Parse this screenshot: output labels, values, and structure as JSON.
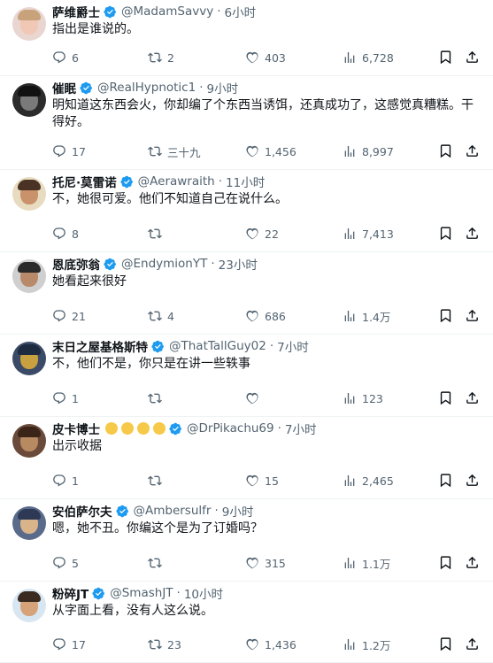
{
  "replies": [
    {
      "name": "萨维爵士",
      "handle": "@MadamSavvy",
      "time": "6小时",
      "text": "指出是谁说的。",
      "replies": "6",
      "reposts": "2",
      "likes": "403",
      "views": "6,728",
      "avatar": {
        "bg": "#e9d6d0",
        "skin": "#f1c7b5",
        "hair": "#c7a27b"
      }
    },
    {
      "name": "催眠",
      "handle": "@RealHypnotic1",
      "time": "9小时",
      "text": "明知道这东西会火，你却编了个东西当诱饵，还真成功了，这感觉真糟糕。干得好。",
      "replies": "17",
      "reposts": "三十九",
      "likes": "1,456",
      "views": "8,997",
      "avatar": {
        "bg": "#2b2b2b",
        "skin": "#7a7a7a",
        "hair": "#111111"
      }
    },
    {
      "name": "托尼·莫雷诺",
      "handle": "@Aerawraith",
      "time": "11小时",
      "text": "不，她很可爱。他们不知道自己在说什么。",
      "replies": "8",
      "reposts": "",
      "likes": "22",
      "views": "7,413",
      "avatar": {
        "bg": "#e8dcc0",
        "skin": "#c9926a",
        "hair": "#4a3324"
      }
    },
    {
      "name": "恩底弥翁",
      "handle": "@EndymionYT",
      "time": "23小时",
      "text": "她看起来很好",
      "replies": "21",
      "reposts": "4",
      "likes": "686",
      "views": "1.4万",
      "avatar": {
        "bg": "#cfcfcf",
        "skin": "#b98a6a",
        "hair": "#2a2a2a"
      }
    },
    {
      "name": "末日之屋基格斯特",
      "handle": "@ThatTallGuy02",
      "time": "7小时",
      "text": "不，他们不是，你只是在讲一些轶事",
      "replies": "1",
      "reposts": "",
      "likes": "",
      "views": "123",
      "avatar": {
        "bg": "#3b4a66",
        "skin": "#c8a040",
        "hair": "#1d2a40"
      }
    },
    {
      "name": "皮卡博士",
      "handle": "@DrPikachu69",
      "time": "7小时",
      "text": "出示收据",
      "replies": "1",
      "reposts": "",
      "likes": "15",
      "views": "2,465",
      "avatar": {
        "bg": "#6a4a3a",
        "skin": "#b88a62",
        "hair": "#3a2418"
      }
    },
    {
      "name": "安伯萨尔夫",
      "handle": "@Ambersulfr",
      "time": "9小时",
      "text": "嗯，她不丑。你编这个是为了订婚吗？",
      "replies": "5",
      "reposts": "",
      "likes": "315",
      "views": "1.1万",
      "avatar": {
        "bg": "#5a6a8a",
        "skin": "#d9b48a",
        "hair": "#2e3a55"
      }
    },
    {
      "name": "粉碎JT",
      "handle": "@SmashJT",
      "time": "10小时",
      "text": "从字面上看，没有人这么说。",
      "replies": "17",
      "reposts": "23",
      "likes": "1,436",
      "views": "1.2万",
      "avatar": {
        "bg": "#d8e6f2",
        "skin": "#d6a27a",
        "hair": "#3a2a20"
      }
    }
  ],
  "colors": {
    "verified": "#1d9bf0",
    "muted": "#536471",
    "text": "#0f1419",
    "divider": "#eff3f4",
    "emoji": "#f7c948"
  },
  "icons": {
    "reply": "reply-icon",
    "repost": "repost-icon",
    "like": "heart-icon",
    "views": "views-icon",
    "bookmark": "bookmark-icon",
    "share": "share-icon",
    "verified": "verified-badge-icon"
  }
}
